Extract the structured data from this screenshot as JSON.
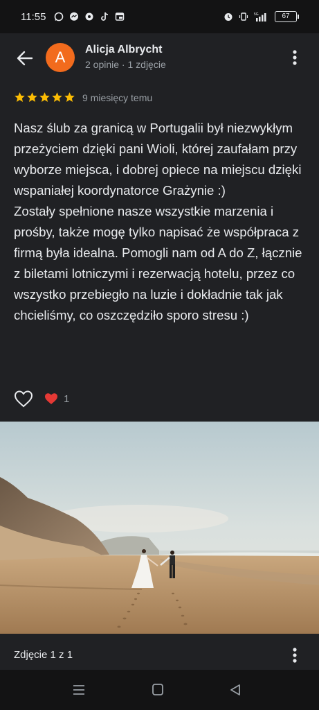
{
  "status_bar": {
    "time": "11:55",
    "battery": "67",
    "icons": [
      "whatsapp-icon",
      "messenger-icon",
      "settings-icon",
      "tiktok-icon",
      "calendar-icon",
      "alarm-icon",
      "vibrate-icon",
      "5g-signal-icon"
    ]
  },
  "review": {
    "author_initial": "A",
    "author_name": "Alicja Albrycht",
    "author_meta": "2 opinie · 1 zdjęcie",
    "rating": 5,
    "time_ago": "9 miesięcy temu",
    "text": "Nasz ślub za granicą w Portugalii był niezwykłym przeżyciem dzięki pani Wioli, której zaufałam przy wyborze miejsca, i dobrej opiece na miejscu dzięki wspaniałej koordynatorce Grażynie :)\nZostały spełnione nasze wszystkie marzenia i prośby, także mogę tylko napisać że współpraca z firmą była idealna. Pomogli nam od A do Z, łącznie z biletami lotniczymi i rezerwacją hotelu, przez co wszystko przebiegło na luzie i dokładnie tak jak chcieliśmy, co oszczędziło sporo stresu :)",
    "reaction_count": "1"
  },
  "photo": {
    "caption": "Zdjęcie 1 z 1"
  },
  "colors": {
    "background": "#202124",
    "avatar": "#f26b1d",
    "star": "#fbbc04",
    "text": "#e8eaed",
    "secondary_text": "#9aa0a6"
  }
}
